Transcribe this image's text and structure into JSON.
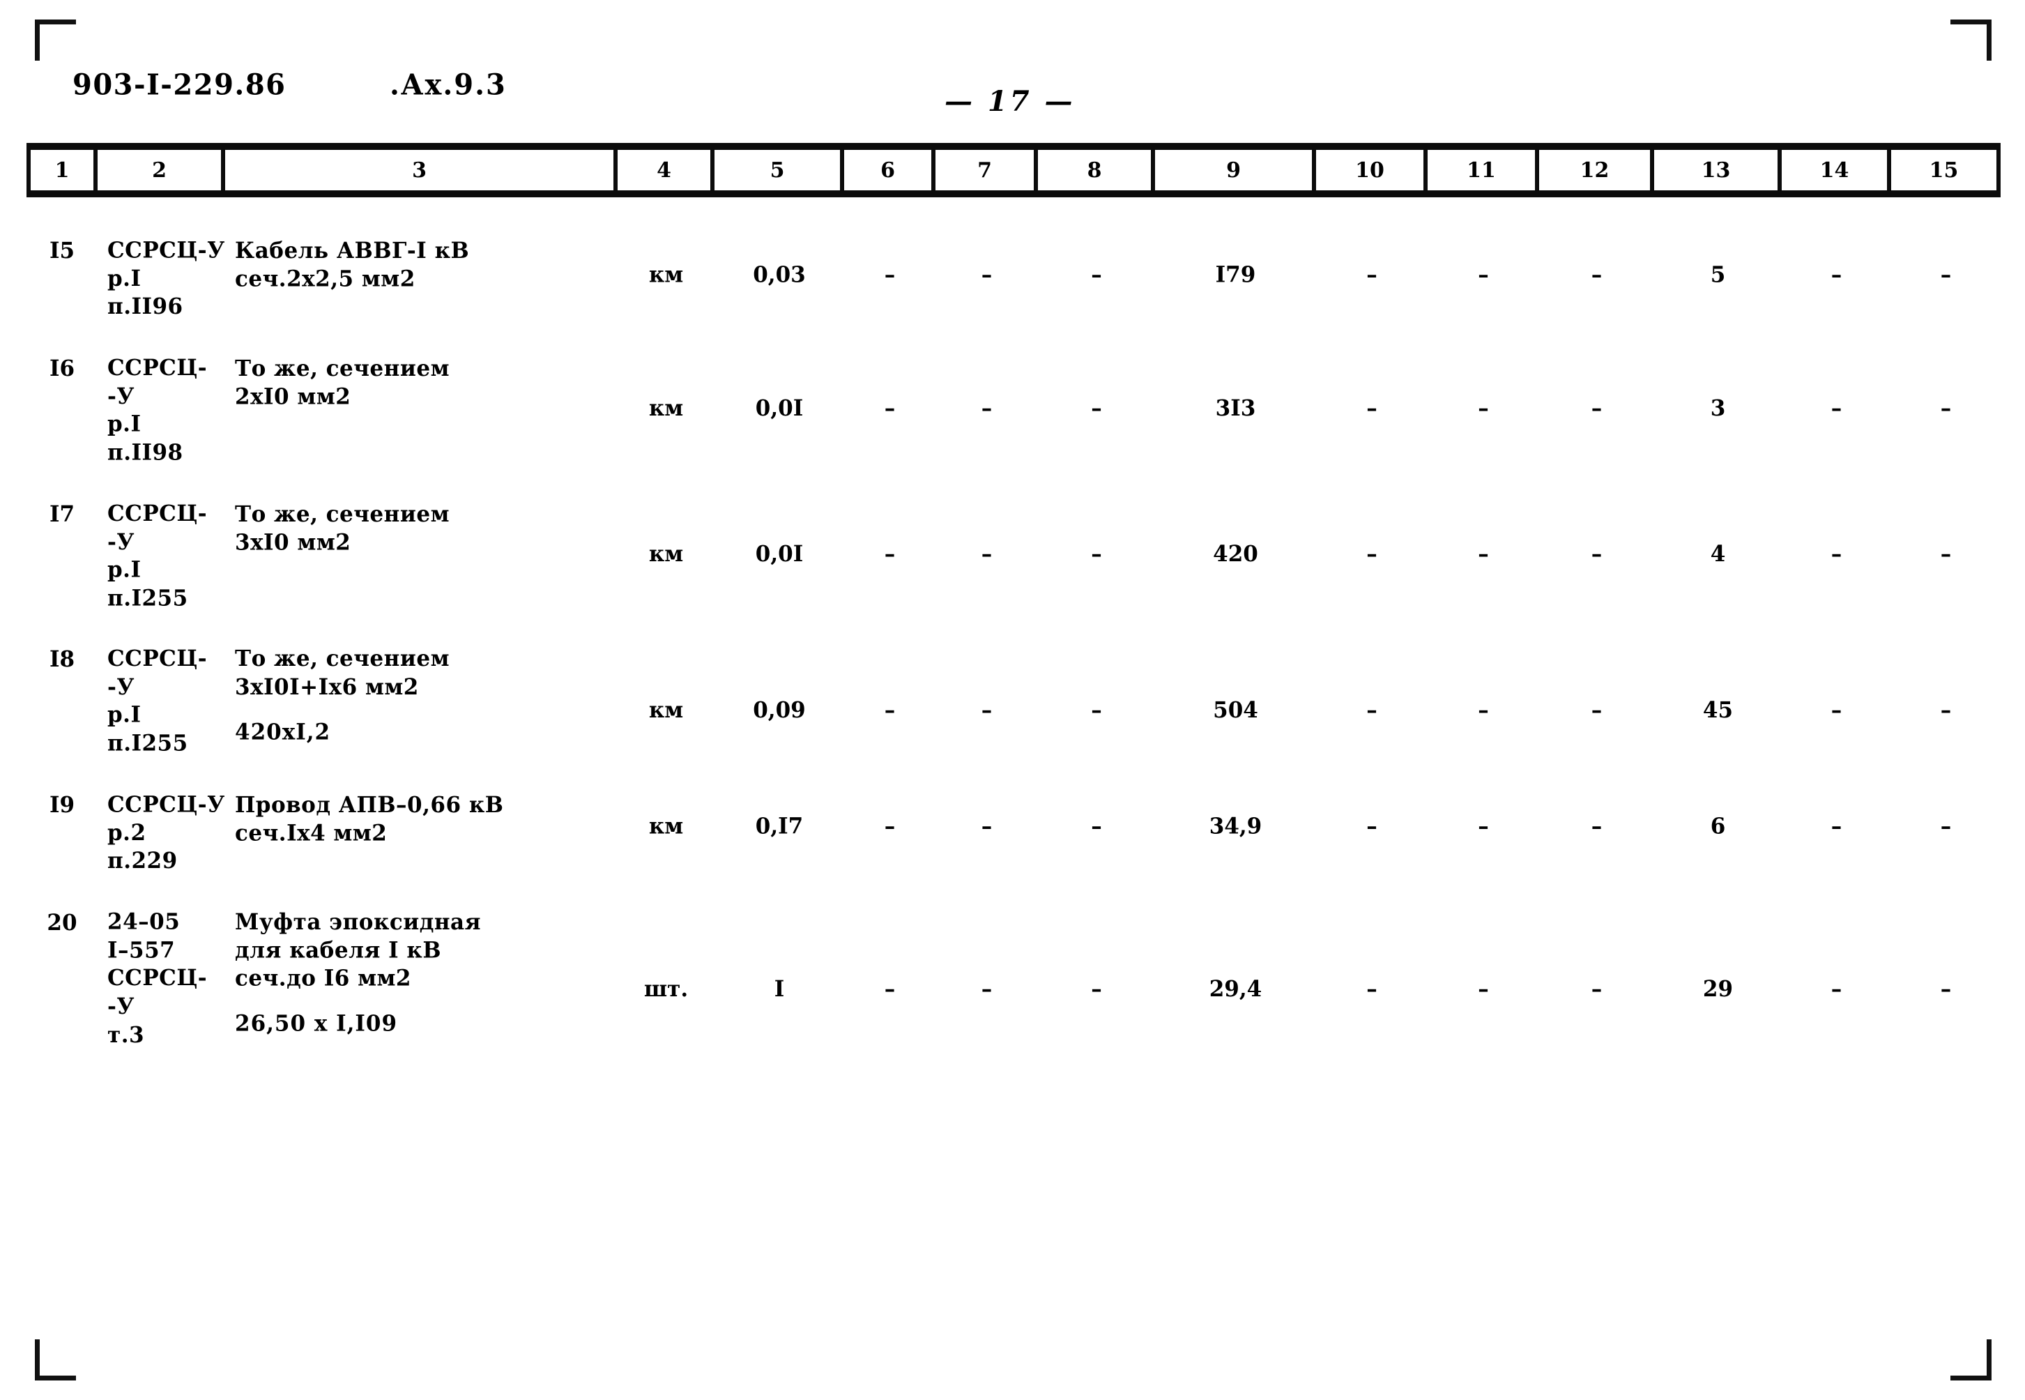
{
  "document": {
    "code": "903-I-229.86",
    "album": ".Ах.9.3",
    "page_label": "— 17 —"
  },
  "table": {
    "column_headers": [
      "1",
      "2",
      "3",
      "4",
      "5",
      "6",
      "7",
      "8",
      "9",
      "10",
      "11",
      "12",
      "13",
      "14",
      "15"
    ],
    "dash": "–",
    "rows": [
      {
        "num": "I5",
        "code": "ССРСЦ-У\nр.I\nп.II96",
        "description": "Кабель АВВГ-I кВ\nсеч.2х2,5 мм2",
        "description_extra": "",
        "unit": "км",
        "c5": "0,03",
        "c6": "–",
        "c7": "–",
        "c8": "–",
        "c9": "I79",
        "c10": "–",
        "c11": "–",
        "c12": "–",
        "c13": "5",
        "c14": "–",
        "c15": "–"
      },
      {
        "num": "I6",
        "code": "ССРСЦ-\n-У\nр.I\nп.II98",
        "description": "То же, сечением\n2хI0 мм2",
        "description_extra": "",
        "unit": "км",
        "c5": "0,0I",
        "c6": "–",
        "c7": "–",
        "c8": "–",
        "c9": "3I3",
        "c10": "–",
        "c11": "–",
        "c12": "–",
        "c13": "3",
        "c14": "–",
        "c15": "–"
      },
      {
        "num": "I7",
        "code": "ССРСЦ-\n-У\nр.I\nп.I255",
        "description": "То же, сечением\n3хI0 мм2",
        "description_extra": "",
        "unit": "км",
        "c5": "0,0I",
        "c6": "–",
        "c7": "–",
        "c8": "–",
        "c9": "420",
        "c10": "–",
        "c11": "–",
        "c12": "–",
        "c13": "4",
        "c14": "–",
        "c15": "–"
      },
      {
        "num": "I8",
        "code": "ССРСЦ-\n-У\nр.I\nп.I255",
        "description": "То же, сечением\n3хI0I+Iх6 мм2",
        "description_extra": "420хI,2",
        "unit": "км",
        "c5": "0,09",
        "c6": "–",
        "c7": "–",
        "c8": "–",
        "c9": "504",
        "c10": "–",
        "c11": "–",
        "c12": "–",
        "c13": "45",
        "c14": "–",
        "c15": "–"
      },
      {
        "num": "I9",
        "code": "ССРСЦ-У\nр.2\nп.229",
        "description": "Провод АПВ–0,66 кВ\nсеч.Iх4 мм2",
        "description_extra": "",
        "unit": "км",
        "c5": "0,I7",
        "c6": "–",
        "c7": "–",
        "c8": "–",
        "c9": "34,9",
        "c10": "–",
        "c11": "–",
        "c12": "–",
        "c13": "6",
        "c14": "–",
        "c15": "–"
      },
      {
        "num": "20",
        "code": "24–05\nI–557\nССРСЦ-\n-У\nт.3",
        "description": "Муфта эпоксидная\nдля кабеля I кВ\nсеч.до I6 мм2",
        "description_extra": "26,50 х I,I09",
        "unit": "шт.",
        "c5": "I",
        "c6": "–",
        "c7": "–",
        "c8": "–",
        "c9": "29,4",
        "c10": "–",
        "c11": "–",
        "c12": "–",
        "c13": "29",
        "c14": "–",
        "c15": "–"
      }
    ]
  }
}
